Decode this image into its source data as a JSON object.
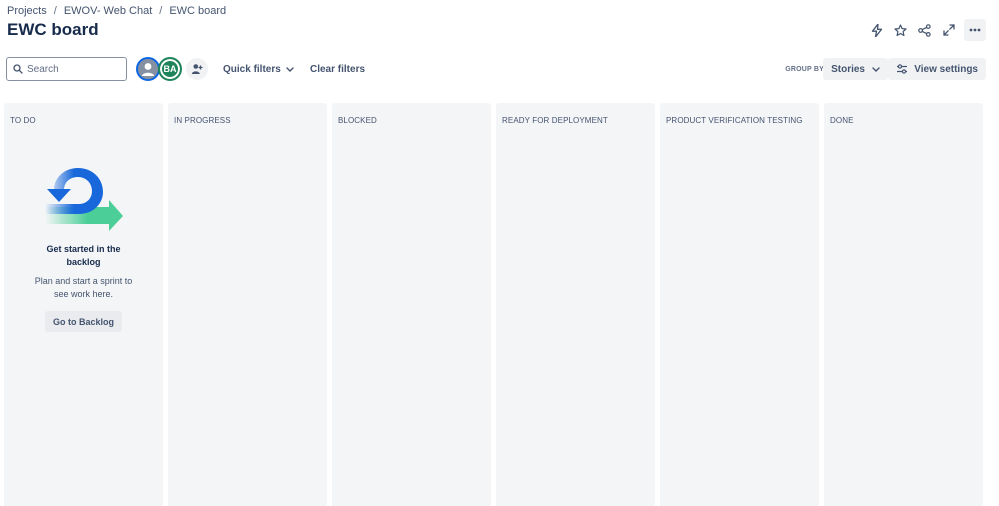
{
  "breadcrumb": [
    "Projects",
    "EWOV- Web Chat",
    "EWC board"
  ],
  "breadcrumb_separator": "/",
  "page_title": "EWC board",
  "top_actions": [
    "automation-icon",
    "star-icon",
    "share-icon",
    "fullscreen-icon",
    "more-icon"
  ],
  "toolbar": {
    "search_placeholder": "Search",
    "avatar_initials": "BA",
    "quick_filters_label": "Quick filters",
    "clear_filters_label": "Clear filters",
    "group_by_label": "GROUP BY",
    "group_by_value": "Stories",
    "view_settings_label": "View settings"
  },
  "columns": [
    {
      "title": "TO DO"
    },
    {
      "title": "IN PROGRESS"
    },
    {
      "title": "BLOCKED"
    },
    {
      "title": "READY FOR DEPLOYMENT"
    },
    {
      "title": "PRODUCT VERIFICATION TESTING"
    },
    {
      "title": "DONE"
    }
  ],
  "empty_state": {
    "title": "Get started in the backlog",
    "description": "Plan and start a sprint to see work here.",
    "button_label": "Go to Backlog"
  },
  "colors": {
    "accent_blue": "#0c66e4",
    "avatar_green": "#1f845a",
    "column_bg": "#f4f5f7",
    "illustration_blue": "#1868db",
    "illustration_green": "#4bce97"
  }
}
